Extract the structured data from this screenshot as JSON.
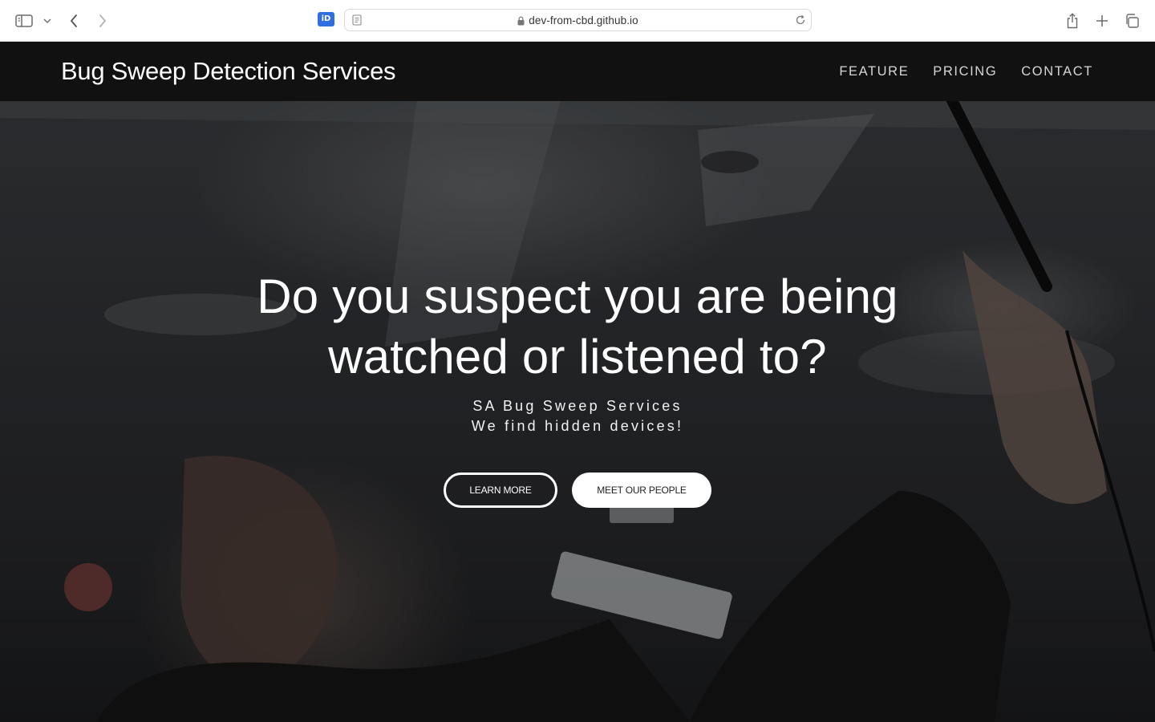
{
  "browser": {
    "url": "dev-from-cbd.github.io",
    "extension_label": "iD"
  },
  "nav": {
    "brand": "Bug Sweep Detection Services",
    "links": [
      "FEATURE",
      "PRICING",
      "CONTACT"
    ]
  },
  "hero": {
    "title_line1": "Do you suspect you are being",
    "title_line2": "watched or listened to?",
    "subtitle_line1": "SA Bug Sweep Services",
    "subtitle_line2": "We find hidden devices!",
    "primary_button": "LEARN MORE",
    "secondary_button": "MEET OUR PEOPLE"
  }
}
